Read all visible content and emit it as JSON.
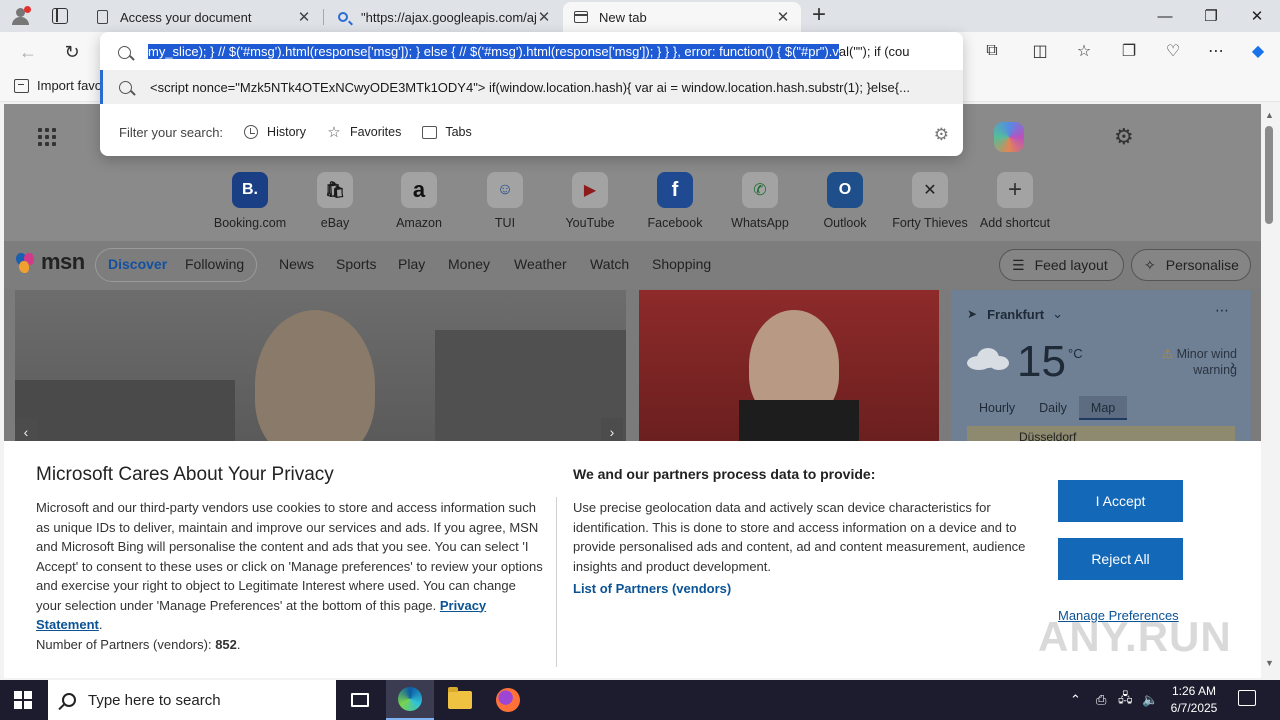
{
  "browser": {
    "tabs": [
      {
        "title": "Access your document",
        "close": "✕"
      },
      {
        "title": "\"https://ajax.googleapis.com/ajax/libs/jquery",
        "close": "✕"
      },
      {
        "title": "New tab",
        "close": "✕"
      }
    ],
    "new_tab_glyph": "+",
    "window_controls": {
      "minimize": "—",
      "maximize": "❐",
      "close": "✕"
    },
    "favorites_bar": {
      "import_label": "Import favo"
    }
  },
  "omnibox": {
    "text_selected": "my_slice); } // $('#msg').html(response['msg']); } else { // $('#msg').html(response['msg']); } } }, error: function() { $(\"#pr\").v",
    "text_rest": "al(\"\"); if (cou",
    "suggestion": "<script nonce=\"Mzk5NTk4OTExNCwyODE3MTk1ODY4\"> if(window.location.hash){ var ai = window.location.hash.substr(1); }else{...",
    "filter_label": "Filter your search:",
    "filters": [
      {
        "label": "History",
        "icon": "history-icon"
      },
      {
        "label": "Favorites",
        "icon": "star-icon"
      },
      {
        "label": "Tabs",
        "icon": "tabs-icon"
      }
    ]
  },
  "newtab": {
    "shortcuts": [
      {
        "name": "Booking.com",
        "glyph": "B."
      },
      {
        "name": "eBay",
        "glyph": "🛍"
      },
      {
        "name": "Amazon",
        "glyph": "a"
      },
      {
        "name": "TUI",
        "glyph": "☺"
      },
      {
        "name": "YouTube",
        "glyph": "▶"
      },
      {
        "name": "Facebook",
        "glyph": "f"
      },
      {
        "name": "WhatsApp",
        "glyph": "✆"
      },
      {
        "name": "Outlook",
        "glyph": "O"
      },
      {
        "name": "Forty Thieves",
        "glyph": "✕"
      },
      {
        "name": "Add shortcut",
        "glyph": "+"
      }
    ],
    "msn": {
      "logo": "msn",
      "nav": [
        "Discover",
        "Following",
        "News",
        "Sports",
        "Play",
        "Money",
        "Weather",
        "Watch",
        "Shopping"
      ],
      "feed_layout": "Feed layout",
      "personalise": "Personalise"
    },
    "weather": {
      "location": "Frankfurt",
      "temp": "15",
      "unit": "°C",
      "warning_line1": "Minor wind",
      "warning_line2": "warning",
      "tabs": [
        "Hourly",
        "Daily",
        "Map"
      ],
      "active_tab": "Map",
      "map_label": "Düsseldorf"
    }
  },
  "privacy": {
    "title": "Microsoft Cares About Your Privacy",
    "body": "Microsoft and our third-party vendors use cookies to store and access information such as unique IDs to deliver, maintain and improve our services and ads. If you agree, MSN and Microsoft Bing will personalise the content and ads that you see. You can select 'I Accept' to consent to these uses or click on 'Manage preferences' to review your options and exercise your right to object to Legitimate Interest where used. You can change your selection under 'Manage Preferences' at the bottom of this page.",
    "privacy_link": "Privacy Statement",
    "partners_count_label": "Number of Partners (vendors):",
    "partners_count": "852",
    "purpose_title": "We and our partners process data to provide:",
    "purpose_body": "Use precise geolocation data and actively scan device characteristics for identification. This is done to store and access information on a device and to provide personalised ads and content, ad and content measurement, audience insights and product development.",
    "partners_link": "List of Partners (vendors)",
    "accept": "I Accept",
    "reject": "Reject All",
    "manage": "Manage Preferences"
  },
  "watermark": "ANY.RUN",
  "taskbar": {
    "search_placeholder": "Type here to search",
    "time": "1:26 AM",
    "date": "6/7/2025"
  }
}
